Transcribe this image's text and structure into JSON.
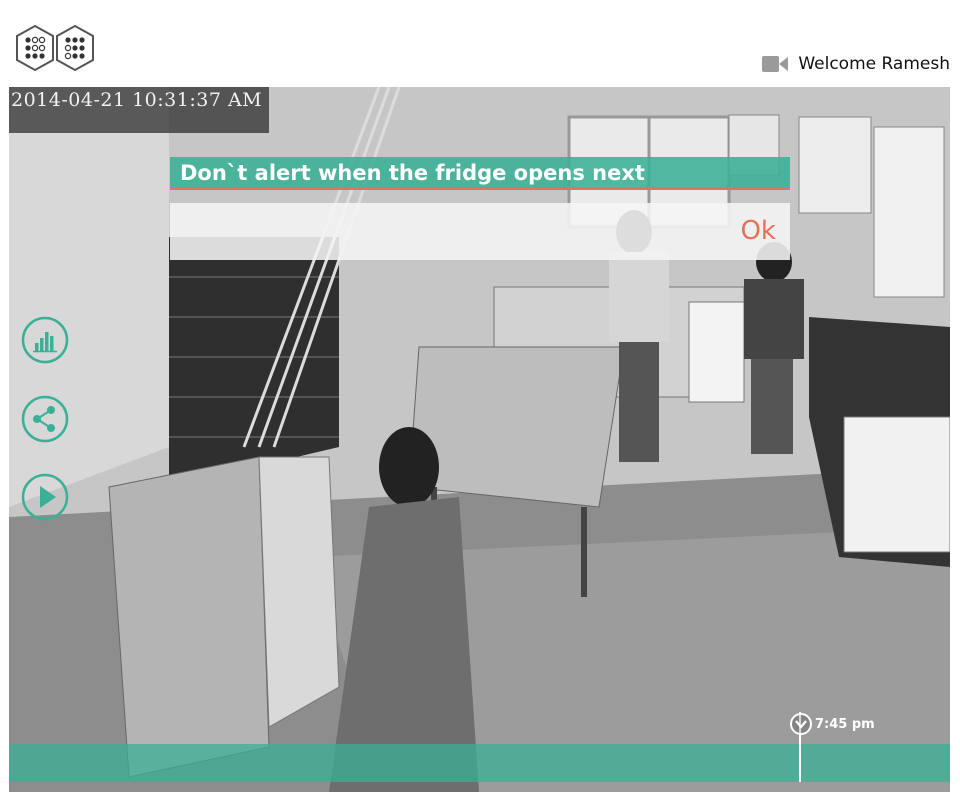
{
  "header": {
    "logo_icon": "hexagon-dots-logo",
    "camera_icon": "video-camera-icon",
    "welcome_text": "Welcome Ramesh"
  },
  "feed": {
    "timestamp": "2014-04-21 10:31:37 AM"
  },
  "alert": {
    "message": "Don`t alert when the fridge opens next",
    "ok_label": "Ok"
  },
  "side_controls": {
    "stats_icon": "bar-chart-icon",
    "share_icon": "share-icon",
    "play_icon": "play-icon"
  },
  "timeline": {
    "time_label": "7:45 pm",
    "pin_icon": "chevron-down-pin-icon"
  },
  "colors": {
    "accent": "#3ab096",
    "alert_text": "#e2735a"
  }
}
